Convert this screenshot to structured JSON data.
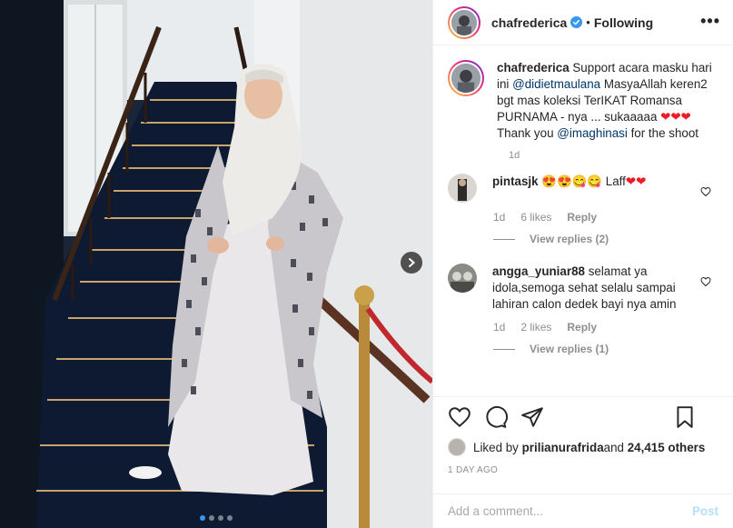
{
  "post": {
    "username": "chafrederica",
    "separator": "•",
    "follow_status": "Following",
    "more_label": "•••",
    "caption": {
      "username": "chafrederica",
      "text_1": " Support acara masku hari ini ",
      "mention_1": "@didietmaulana",
      "text_2": " MasyaAllah keren2 bgt mas koleksi TerIKAT Romansa PURNAMA - nya ... sukaaaaa ",
      "hearts": "❤❤❤",
      "text_3": " Thank you ",
      "mention_2": "@imaghinasi",
      "text_4": " for the shoot",
      "age": "1d"
    },
    "comments": [
      {
        "username": "pintasjk",
        "text": " 😍😍😋😋 Laff",
        "hearts": "❤❤",
        "age": "1d",
        "likes": "6 likes",
        "reply_label": "Reply",
        "view_replies": "View replies (2)"
      },
      {
        "username": "angga_yuniar88",
        "text": " selamat ya idola,semoga sehat selalu sampai lahiran calon dedek bayi nya amin",
        "hearts": "",
        "age": "1d",
        "likes": "2 likes",
        "reply_label": "Reply",
        "view_replies": "View replies (1)"
      }
    ],
    "likes": {
      "prefix": "Liked by ",
      "first_user": "prilianurafrida",
      "middle": " and ",
      "others": "24,415 others"
    },
    "timestamp": "1 DAY AGO",
    "add_comment_placeholder": "Add a comment...",
    "post_label": "Post",
    "carousel": {
      "count": 4,
      "active_index": 0
    }
  },
  "colors": {
    "accent": "#3897f0",
    "mention": "#003569",
    "heart": "#ed1c24",
    "muted": "#8e8e8e",
    "post_disabled": "#b2dffc"
  },
  "icons": {
    "verified": "verified-badge-icon",
    "like": "heart-outline-icon",
    "comment": "comment-bubble-icon",
    "share": "paper-plane-icon",
    "save": "bookmark-icon",
    "next": "chevron-right-icon"
  }
}
